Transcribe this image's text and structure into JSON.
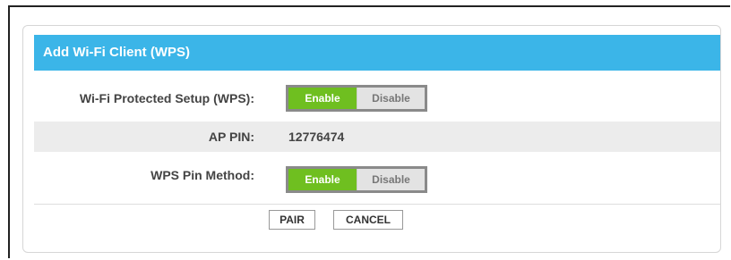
{
  "panel": {
    "title": "Add Wi-Fi Client (WPS)"
  },
  "rows": {
    "wps": {
      "label": "Wi-Fi Protected Setup (WPS):",
      "enable_label": "Enable",
      "disable_label": "Disable",
      "selected": "Enable"
    },
    "ap_pin": {
      "label": "AP PIN:",
      "value": "12776474"
    },
    "wps_pin_method": {
      "label": "WPS Pin Method:",
      "enable_label": "Enable",
      "disable_label": "Disable",
      "selected": "Enable"
    }
  },
  "buttons": {
    "pair_label": "PAIR",
    "cancel_label": "CANCEL"
  },
  "colors": {
    "header": "#3bb5e8",
    "toggle_on": "#6fbf20",
    "alt_row": "#ececec"
  }
}
